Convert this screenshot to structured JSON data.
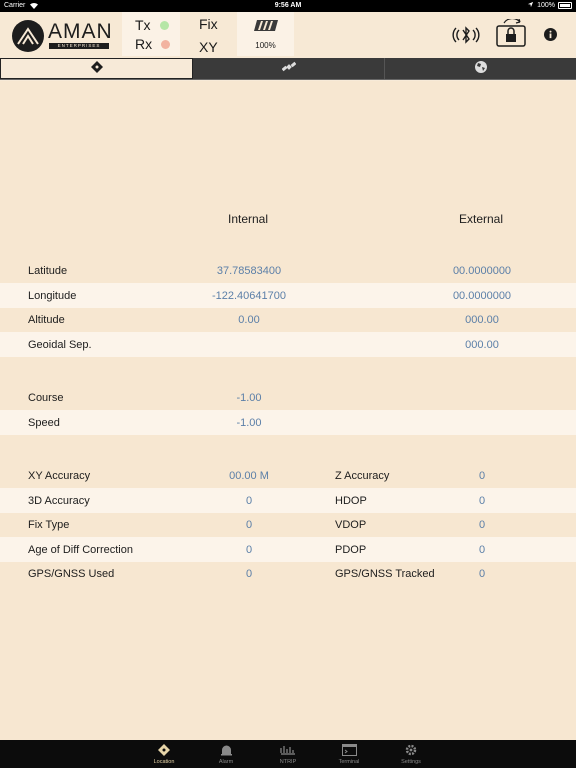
{
  "status_bar": {
    "carrier": "Carrier",
    "time": "9:56 AM",
    "battery": "100%"
  },
  "header": {
    "logo_text": "AMAN",
    "logo_sub": "ENTERPRISES",
    "tx_label": "Tx",
    "rx_label": "Rx",
    "fix_label": "Fix",
    "fix_value": "XY",
    "battery_pct": "100%",
    "tx_color": "#b6e6a6",
    "rx_color": "#f2b3a0"
  },
  "tabs": [
    {
      "icon": "location-diamond-icon",
      "active": true
    },
    {
      "icon": "satellite-icon",
      "active": false
    },
    {
      "icon": "globe-icon",
      "active": false
    }
  ],
  "columns": {
    "internal": "Internal",
    "external": "External"
  },
  "position_rows": [
    {
      "label": "Latitude",
      "internal": "37.78583400",
      "external": "00.0000000"
    },
    {
      "label": "Longitude",
      "internal": "-122.40641700",
      "external": "00.0000000"
    },
    {
      "label": "Altitude",
      "internal": "0.00",
      "external": "000.00"
    },
    {
      "label": "Geoidal Sep.",
      "internal": "",
      "external": "000.00"
    }
  ],
  "motion_rows": [
    {
      "label": "Course",
      "internal": "-1.00"
    },
    {
      "label": "Speed",
      "internal": "-1.00"
    }
  ],
  "accuracy_rows": [
    {
      "label": "XY Accuracy",
      "value": "00.00 M",
      "label2": "Z Accuracy",
      "value2": "0"
    },
    {
      "label": "3D Accuracy",
      "value": "0",
      "label2": "HDOP",
      "value2": "0"
    },
    {
      "label": "Fix Type",
      "value": "0",
      "label2": "VDOP",
      "value2": "0"
    },
    {
      "label": "Age of Diff Correction",
      "value": "0",
      "label2": "PDOP",
      "value2": "0"
    },
    {
      "label": "GPS/GNSS Used",
      "value": "0",
      "label2": "GPS/GNSS Tracked",
      "value2": "0"
    }
  ],
  "tabbar": [
    {
      "label": "Location",
      "icon": "location-icon",
      "active": true
    },
    {
      "label": "Alarm",
      "icon": "alarm-icon",
      "active": false
    },
    {
      "label": "NTRIP",
      "icon": "ntrip-icon",
      "active": false
    },
    {
      "label": "Terminal",
      "icon": "terminal-icon",
      "active": false
    },
    {
      "label": "Settings",
      "icon": "gear-icon",
      "active": false
    }
  ],
  "colors": {
    "value_blue": "#5b7fa8",
    "background": "#f7e7d1",
    "row_alt": "#fcf4ea"
  }
}
